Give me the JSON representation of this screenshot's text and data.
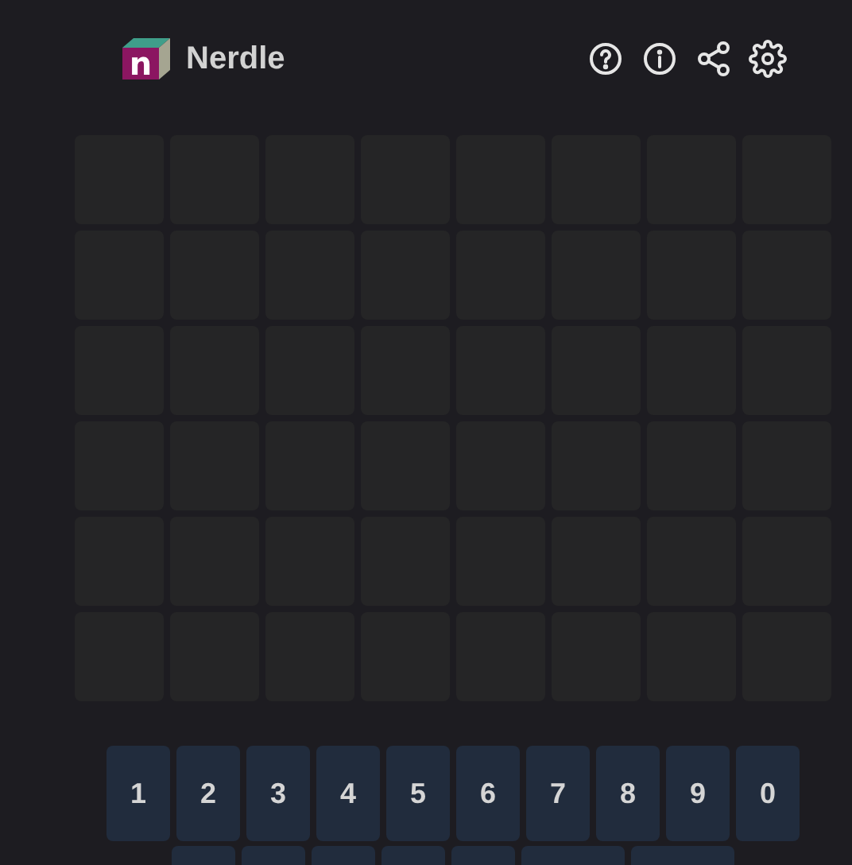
{
  "header": {
    "logo_letter": "n",
    "title": "Nerdle",
    "icons": [
      {
        "kind": "help"
      },
      {
        "kind": "info"
      },
      {
        "kind": "share"
      },
      {
        "kind": "settings"
      }
    ]
  },
  "grid": [
    {
      "cells": [
        {
          "filled": false
        },
        {
          "filled": false
        },
        {
          "filled": false
        },
        {
          "filled": false
        },
        {
          "filled": false
        },
        {
          "filled": false
        },
        {
          "filled": false
        },
        {
          "filled": false
        }
      ]
    },
    {
      "cells": [
        {
          "filled": false
        },
        {
          "filled": false
        },
        {
          "filled": false
        },
        {
          "filled": false
        },
        {
          "filled": false
        },
        {
          "filled": false
        },
        {
          "filled": false
        },
        {
          "filled": false
        }
      ]
    },
    {
      "cells": [
        {
          "filled": false
        },
        {
          "filled": false
        },
        {
          "filled": false
        },
        {
          "filled": false
        },
        {
          "filled": false
        },
        {
          "filled": false
        },
        {
          "filled": false
        },
        {
          "filled": false
        }
      ]
    },
    {
      "cells": [
        {
          "filled": false
        },
        {
          "filled": false
        },
        {
          "filled": false
        },
        {
          "filled": false
        },
        {
          "filled": false
        },
        {
          "filled": false
        },
        {
          "filled": false
        },
        {
          "filled": false
        }
      ]
    },
    {
      "cells": [
        {
          "filled": false
        },
        {
          "filled": false
        },
        {
          "filled": false
        },
        {
          "filled": false
        },
        {
          "filled": false
        },
        {
          "filled": false
        },
        {
          "filled": false
        },
        {
          "filled": false
        }
      ]
    },
    {
      "cells": [
        {
          "filled": false
        },
        {
          "filled": false
        },
        {
          "filled": false
        },
        {
          "filled": false
        },
        {
          "filled": false
        },
        {
          "filled": false
        },
        {
          "filled": false
        },
        {
          "filled": false
        }
      ]
    }
  ],
  "keyboard": [
    {
      "keys": [
        {
          "kind": "key",
          "label": "1"
        },
        {
          "kind": "key",
          "label": "2"
        },
        {
          "kind": "key",
          "label": "3"
        },
        {
          "kind": "key",
          "label": "4"
        },
        {
          "kind": "key",
          "label": "5"
        },
        {
          "kind": "key",
          "label": "6"
        },
        {
          "kind": "key",
          "label": "7"
        },
        {
          "kind": "key",
          "label": "8"
        },
        {
          "kind": "key",
          "label": "9"
        },
        {
          "kind": "key",
          "label": "0"
        }
      ]
    },
    {
      "keys": [
        {
          "kind": "key"
        },
        {
          "kind": "key"
        },
        {
          "kind": "key"
        },
        {
          "kind": "key"
        },
        {
          "kind": "key"
        },
        {
          "kind": "wide"
        },
        {
          "kind": "wide"
        }
      ]
    }
  ]
}
